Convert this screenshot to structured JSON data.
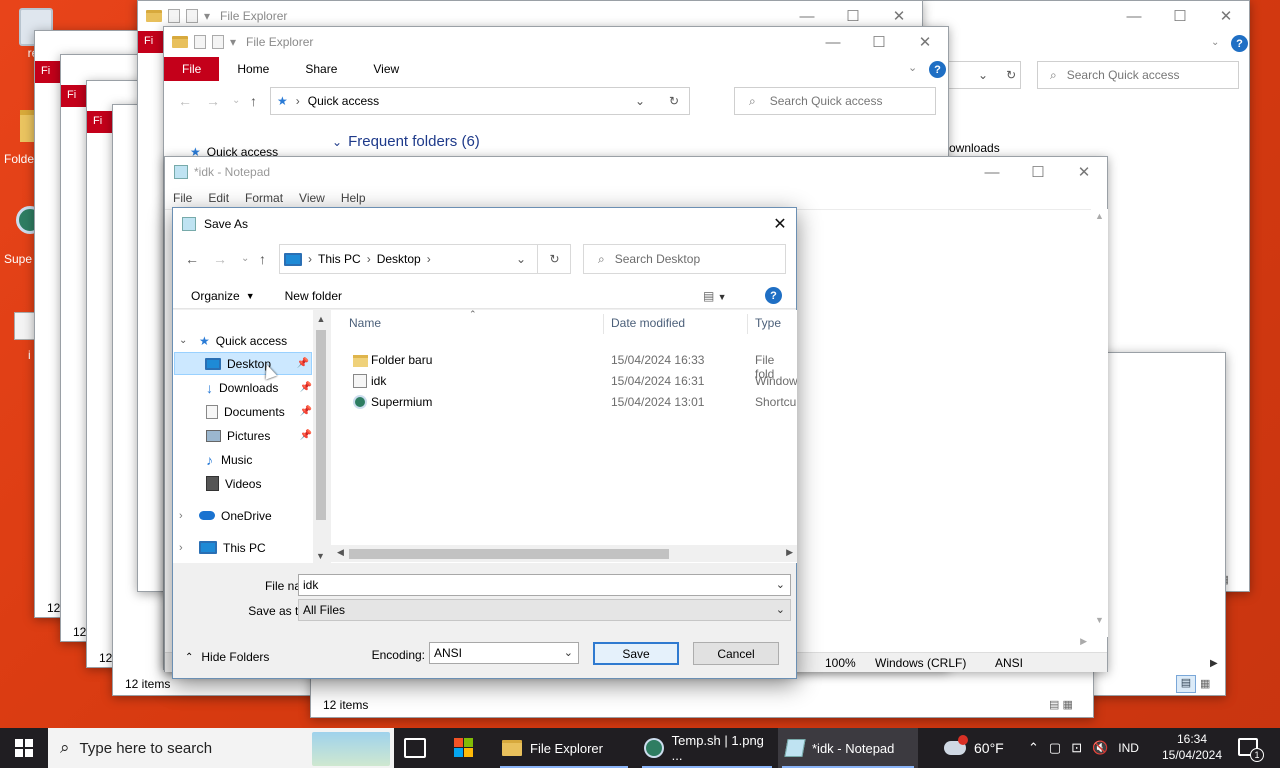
{
  "desktop": {
    "icons": [
      {
        "label": "rec"
      },
      {
        "label": "Folde"
      },
      {
        "label": "Supe"
      },
      {
        "label": "i"
      }
    ]
  },
  "explorer_back": {
    "title": "File Explorer",
    "search_placeholder": "Search Quick access",
    "downloads_partial": "ownloads"
  },
  "explorer_main": {
    "title": "File Explorer",
    "tabs": {
      "file": "File",
      "home": "Home",
      "share": "Share",
      "view": "View"
    },
    "address": "Quick access",
    "search_placeholder": "Search Quick access",
    "nav_quick_access": "Quick access",
    "frequent_folders": "Frequent folders (6)"
  },
  "stacked_windows": {
    "tab_label": "Fi",
    "item_counts": [
      "12",
      "12",
      "12",
      "12 items",
      "12 items"
    ]
  },
  "notepad": {
    "title": "*idk - Notepad",
    "menu": [
      "File",
      "Edit",
      "Format",
      "View",
      "Help"
    ],
    "status": {
      "zoom": "100%",
      "line_ending": "Windows (CRLF)",
      "encoding": "ANSI"
    }
  },
  "save_as": {
    "title": "Save As",
    "address": {
      "root": "This PC",
      "current": "Desktop"
    },
    "search_placeholder": "Search Desktop",
    "organize": "Organize",
    "new_folder": "New folder",
    "nav": [
      {
        "label": "Quick access"
      },
      {
        "label": "Desktop"
      },
      {
        "label": "Downloads"
      },
      {
        "label": "Documents"
      },
      {
        "label": "Pictures"
      },
      {
        "label": "Music"
      },
      {
        "label": "Videos"
      },
      {
        "label": "OneDrive"
      },
      {
        "label": "This PC"
      }
    ],
    "columns": {
      "name": "Name",
      "date": "Date modified",
      "type": "Type"
    },
    "files": [
      {
        "name": "Folder baru",
        "date": "15/04/2024 16:33",
        "type": "File fold"
      },
      {
        "name": "idk",
        "date": "15/04/2024 16:31",
        "type": "Window"
      },
      {
        "name": "Supermium",
        "date": "15/04/2024 13:01",
        "type": "Shortcu"
      }
    ],
    "file_name_label": "File name:",
    "file_name_value": "idk",
    "save_as_type_label": "Save as type:",
    "save_as_type_value": "All Files",
    "encoding_label": "Encoding:",
    "encoding_value": "ANSI",
    "hide_folders": "Hide Folders",
    "save_button": "Save",
    "cancel_button": "Cancel"
  },
  "taskbar": {
    "search_placeholder": "Type here to search",
    "apps": [
      {
        "label": "File Explorer"
      },
      {
        "label": "Temp.sh | 1.png ..."
      },
      {
        "label": "*idk - Notepad"
      }
    ],
    "weather": "60°F",
    "language": "IND",
    "time": "16:34",
    "date": "15/04/2024",
    "notification_count": "1"
  }
}
